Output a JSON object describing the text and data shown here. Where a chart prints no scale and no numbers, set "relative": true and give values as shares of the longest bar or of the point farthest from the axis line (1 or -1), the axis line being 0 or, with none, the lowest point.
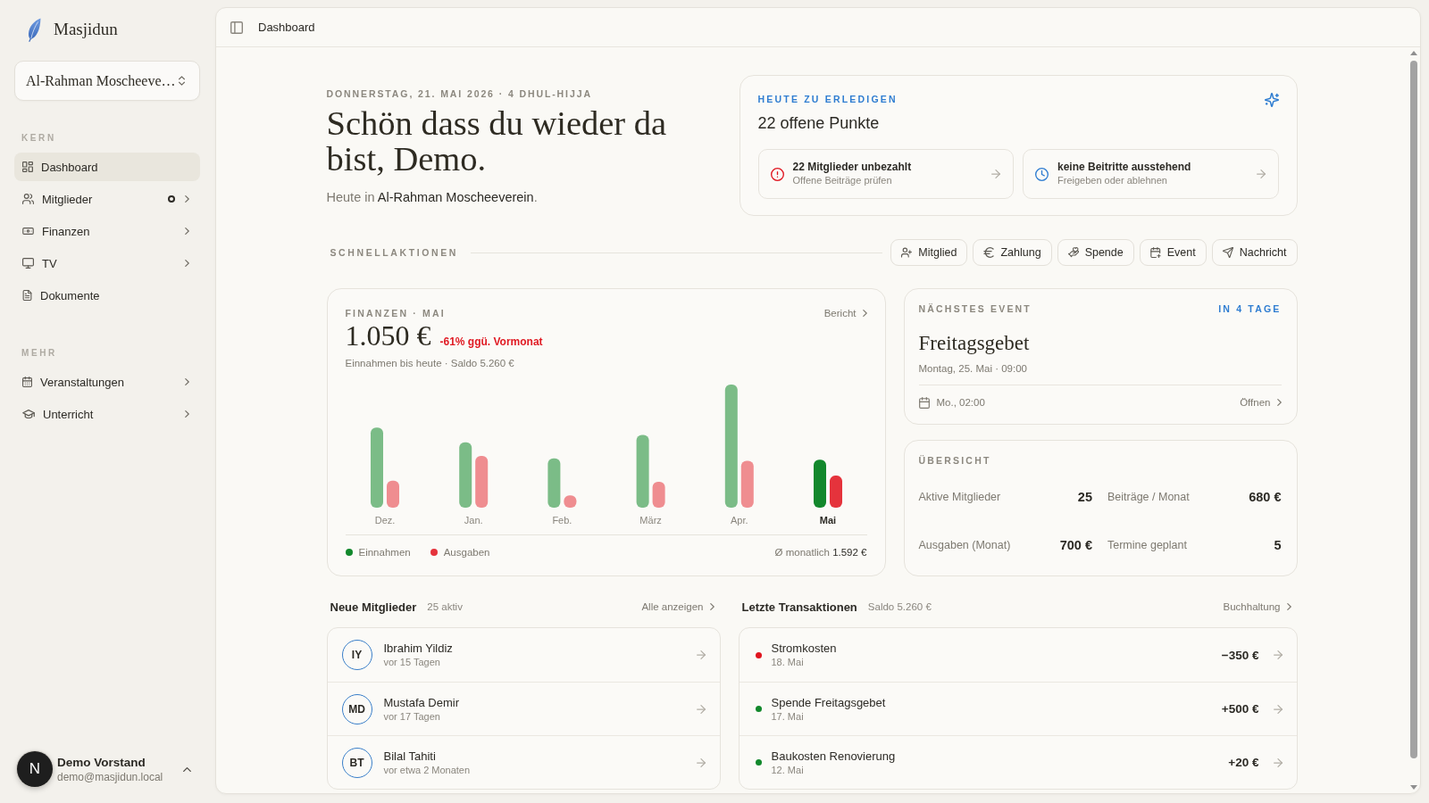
{
  "sidebar": {
    "brand": "Masjidun",
    "organization_selector": {
      "value": "Al-Rahman Moscheeve…"
    },
    "sections": [
      {
        "heading": "KERN",
        "items": [
          {
            "label": "Dashboard",
            "selected": true,
            "notification": false,
            "expandable": false
          },
          {
            "label": "Mitglieder",
            "selected": false,
            "notification": true,
            "expandable": true
          },
          {
            "label": "Finanzen",
            "selected": false,
            "notification": false,
            "expandable": true
          },
          {
            "label": "TV",
            "selected": false,
            "notification": false,
            "expandable": true
          },
          {
            "label": "Dokumente",
            "selected": false,
            "notification": false,
            "expandable": false
          }
        ]
      },
      {
        "heading": "MEHR",
        "items": [
          {
            "label": "Veranstaltungen",
            "selected": false,
            "notification": false,
            "expandable": true
          },
          {
            "label": "Unterricht",
            "selected": false,
            "notification": false,
            "expandable": true
          }
        ]
      }
    ],
    "user": {
      "avatar": "N",
      "name": "Demo Vorstand",
      "email": "demo@masjidun.local"
    }
  },
  "header": {
    "title": "Dashboard"
  },
  "hero": {
    "date": "DONNERSTAG, 21. MAI 2026 · 4 DHUL-HIJJA",
    "greeting": "Schön dass du wieder da bist, Demo.",
    "subtitle": "Heute in **Al-Rahman Moscheeverein**."
  },
  "todo": {
    "label": "HEUTE ZU ERLEDIGEN",
    "title": "22 offene Punkte",
    "items": [
      {
        "kind": "alert",
        "title": "22 Mitglieder unbezahlt",
        "subtitle": "Offene Beiträge prüfen"
      },
      {
        "kind": "pending",
        "title": "keine Beitritte ausstehend",
        "subtitle": "Freigeben oder ablehnen"
      }
    ]
  },
  "quick_actions": {
    "label": "SCHNELLAKTIONEN",
    "buttons": [
      "Mitglied",
      "Zahlung",
      "Spende",
      "Event",
      "Nachricht"
    ]
  },
  "finances": {
    "label": "FINANZEN · MAI",
    "link": "Bericht",
    "amount": "1.050 €",
    "change": "-61% ggü. Vormonat",
    "negative": true,
    "subtitle": "Einnahmen bis heute · Saldo 5.260 €",
    "chart_data": {
      "type": "bar",
      "relative": true,
      "categories": [
        "Dez.",
        "Jan.",
        "Feb.",
        "März",
        "Apr.",
        "Mai"
      ],
      "series": [
        {
          "name": "Einnahmen",
          "color": "#12882c",
          "values": [
            0.65,
            0.53,
            0.4,
            0.59,
            1.0,
            0.39
          ]
        },
        {
          "name": "Ausgaben",
          "color": "#e5333c",
          "values": [
            0.22,
            0.42,
            0.1,
            0.21,
            0.38,
            0.26
          ]
        }
      ]
    },
    "average": "Ø monatlich **1.592 €**"
  },
  "next_event": {
    "label": "NÄCHSTES EVENT",
    "countdown": "IN 4 TAGE",
    "title": "Freitagsgebet",
    "datetime": "Montag, 25. Mai · 09:00",
    "time": "Mo., 02:00",
    "link": "Öffnen"
  },
  "overview": {
    "label": "ÜBERSICHT",
    "stats": [
      {
        "label": "Aktive Mitglieder",
        "value": "25"
      },
      {
        "label": "Beiträge / Monat",
        "value": "680 €"
      },
      {
        "label": "Ausgaben (Monat)",
        "value": "700 €"
      },
      {
        "label": "Termine geplant",
        "value": "5"
      }
    ]
  },
  "new_members": {
    "title": "Neue Mitglieder",
    "count": "25 aktiv",
    "link": "Alle anzeigen",
    "rows": [
      {
        "initials": "IY",
        "name": "Ibrahim Yildiz",
        "joined": "vor 15 Tagen"
      },
      {
        "initials": "MD",
        "name": "Mustafa Demir",
        "joined": "vor 17 Tagen"
      },
      {
        "initials": "BT",
        "name": "Bilal Tahiti",
        "joined": "vor etwa 2 Monaten"
      }
    ]
  },
  "transactions": {
    "title": "Letzte Transaktionen",
    "balance": "Saldo 5.260 €",
    "link": "Buchhaltung",
    "rows": [
      {
        "title": "Stromkosten",
        "date": "18. Mai",
        "amount": "−350 €",
        "color": "#e0151f"
      },
      {
        "title": "Spende Freitagsgebet",
        "date": "17. Mai",
        "amount": "+500 €",
        "color": "#12882c"
      },
      {
        "title": "Baukosten Renovierung",
        "date": "12. Mai",
        "amount": "+20 €",
        "color": "#12882c"
      }
    ]
  }
}
